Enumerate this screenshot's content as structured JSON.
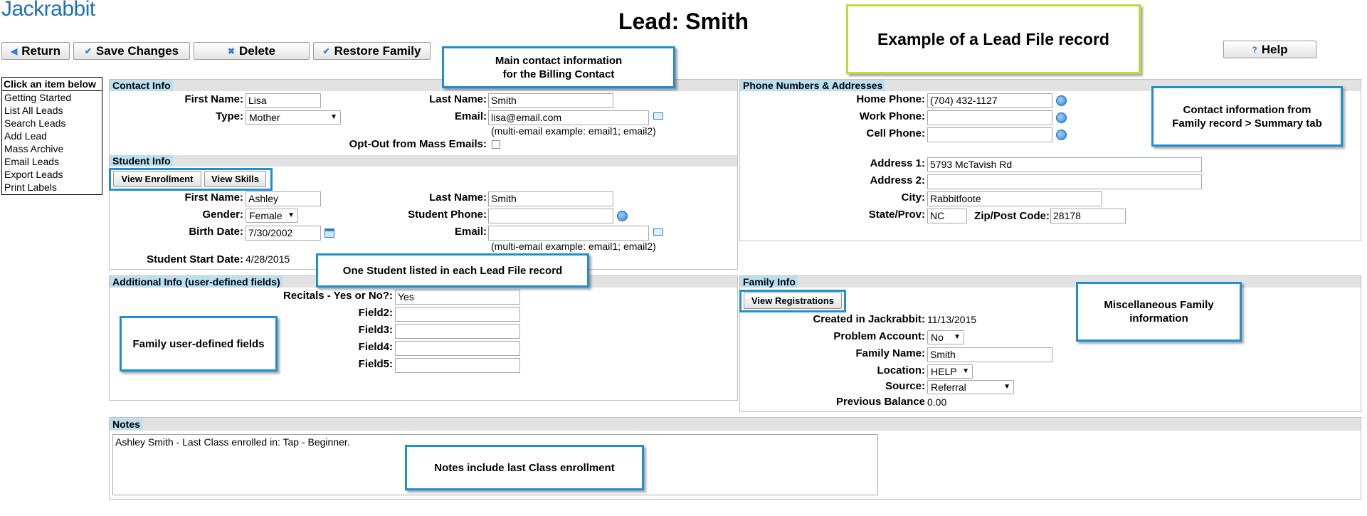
{
  "app": {
    "logo": "Jackrabbit",
    "title": "Lead: Smith"
  },
  "toolbar": {
    "return": "Return",
    "save": "Save Changes",
    "delete": "Delete",
    "restore": "Restore Family",
    "help": "Help"
  },
  "sidebar": {
    "header": "Click an item below",
    "items": [
      "Getting Started",
      "List All Leads",
      "Search Leads",
      "Add Lead",
      "Mass Archive",
      "Email Leads",
      "Export Leads",
      "Print Labels"
    ]
  },
  "callouts": {
    "example": "Example of a Lead File record",
    "main_contact": "Main contact information\nfor the Billing Contact",
    "contact_from_family": "Contact information from\nFamily record > Summary tab",
    "one_student": "One Student listed in each Lead File record",
    "family_udf": "Family user-defined fields",
    "misc_family": "Miscellaneous Family\ninformation",
    "notes_last_class": "Notes include last Class enrollment"
  },
  "contact": {
    "title": "Contact Info",
    "first_name_label": "First Name:",
    "first_name": "Lisa",
    "last_name_label": "Last Name:",
    "last_name": "Smith",
    "type_label": "Type:",
    "type": "Mother",
    "email_label": "Email:",
    "email": "lisa@email.com",
    "email_hint": "(multi-email example: email1; email2)",
    "optout_label": "Opt-Out from Mass Emails:"
  },
  "student": {
    "title": "Student Info",
    "view_enrollment": "View Enrollment",
    "view_skills": "View Skills",
    "first_name_label": "First Name:",
    "first_name": "Ashley",
    "last_name_label": "Last Name:",
    "last_name": "Smith",
    "gender_label": "Gender:",
    "gender": "Female",
    "phone_label": "Student Phone:",
    "phone": "",
    "birth_label": "Birth Date:",
    "birth": "7/30/2002",
    "email_label": "Email:",
    "email": "",
    "email_hint": "(multi-email example: email1; email2)",
    "start_label": "Student Start Date:",
    "start": "4/28/2015"
  },
  "phone": {
    "title": "Phone Numbers & Addresses",
    "home_label": "Home Phone:",
    "home": "(704) 432-1127",
    "work_label": "Work Phone:",
    "work": "",
    "cell_label": "Cell Phone:",
    "cell": "",
    "addr1_label": "Address 1:",
    "addr1": "5793 McTavish Rd",
    "addr2_label": "Address 2:",
    "addr2": "",
    "city_label": "City:",
    "city": "Rabbitfoote",
    "state_label": "State/Prov:",
    "state": "NC",
    "zip_label": "Zip/Post Code:",
    "zip": "28178"
  },
  "additional": {
    "title": "Additional Info (user-defined fields)",
    "recitals_label": "Recitals - Yes or No?:",
    "recitals": "Yes",
    "field2_label": "Field2:",
    "field3_label": "Field3:",
    "field4_label": "Field4:",
    "field5_label": "Field5:"
  },
  "family": {
    "title": "Family Info",
    "view_registrations": "View Registrations",
    "created_label": "Created in Jackrabbit:",
    "created": "11/13/2015",
    "problem_label": "Problem Account:",
    "problem": "No",
    "family_name_label": "Family Name:",
    "family_name": "Smith",
    "location_label": "Location:",
    "location": "HELP",
    "source_label": "Source:",
    "source": "Referral",
    "balance_label": "Previous Balance",
    "balance": "0.00"
  },
  "notes": {
    "title": "Notes",
    "text": "Ashley Smith - Last Class enrolled in: Tap - Beginner."
  },
  "colors": {
    "callout_blue": "#1e8fd0",
    "callout_green": "#c4d936",
    "section_head": "#b9dff0",
    "logo_blue": "#1f6fb5"
  }
}
